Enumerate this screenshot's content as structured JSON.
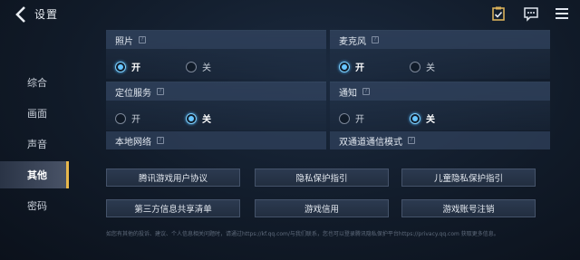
{
  "header": {
    "title": "设置",
    "icons": [
      "back-arrow-icon",
      "clipboard-check-icon",
      "chat-icon",
      "menu-icon"
    ]
  },
  "sidebar": {
    "items": [
      {
        "label": "综合"
      },
      {
        "label": "画面"
      },
      {
        "label": "声音"
      },
      {
        "label": "其他",
        "active": true
      },
      {
        "label": "密码"
      }
    ]
  },
  "settings": {
    "photo": {
      "label": "照片",
      "on": "开",
      "off": "关",
      "selected": "on"
    },
    "mic": {
      "label": "麦克风",
      "on": "开",
      "off": "关",
      "selected": "on"
    },
    "location": {
      "label": "定位服务",
      "on": "开",
      "off": "关",
      "selected": "off"
    },
    "notify": {
      "label": "通知",
      "on": "开",
      "off": "关",
      "selected": "off"
    },
    "local_network": {
      "label": "本地网络"
    },
    "dual_channel": {
      "label": "双通道通信模式"
    }
  },
  "buttons": {
    "user_agreement": "腾讯游戏用户协议",
    "privacy": "隐私保护指引",
    "child_privacy": "儿童隐私保护指引",
    "third_party": "第三方信息共享清单",
    "credit": "游戏信用",
    "cancel_account": "游戏账号注销"
  },
  "footer": {
    "text": "如您有其他的投诉、建议、个人信息相关问题时，请通过https://kf.qq.com/与我们联系，您也可以登录腾讯隐私保护平台https://privacy.qq.com 获取更多信息。"
  },
  "colors": {
    "accent_gold": "#e8b84c",
    "radio_on": "#67c5ff"
  }
}
